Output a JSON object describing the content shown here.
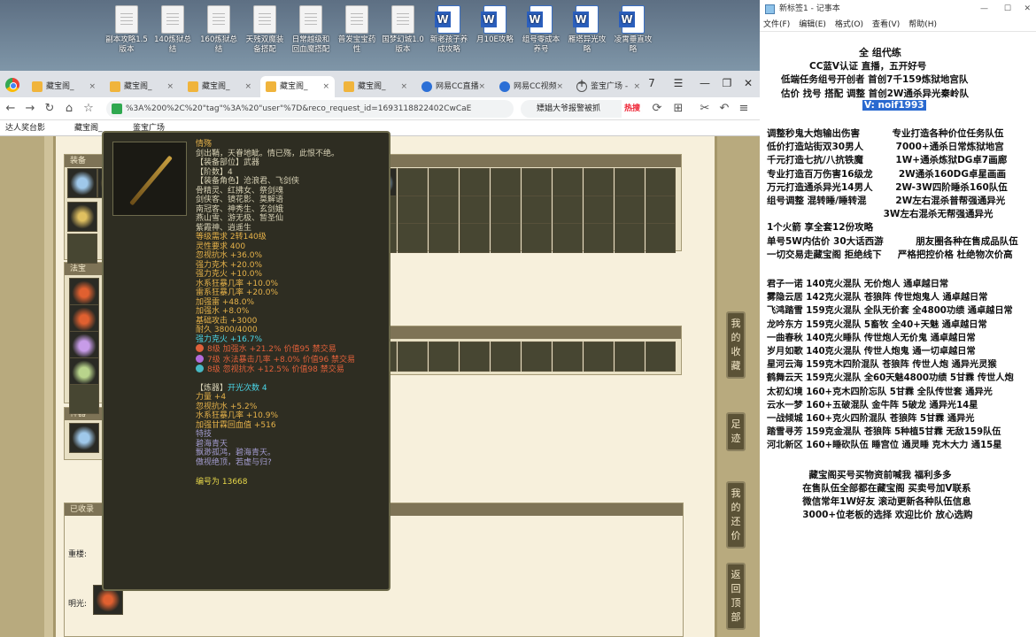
{
  "desktop": {
    "icons": [
      {
        "label": "副本攻略1.5\n版本",
        "type": "txt"
      },
      {
        "label": "140炼狱总结",
        "type": "txt"
      },
      {
        "label": "160炼狱总结",
        "type": "txt"
      },
      {
        "label": "天残双魔装\n备搭配",
        "type": "txt"
      },
      {
        "label": "日常越级和\n回血魔搭配",
        "type": "txt"
      },
      {
        "label": "普发宝宝药\n性",
        "type": "txt"
      },
      {
        "label": "国梦幻城1.0\n版本",
        "type": "txt"
      },
      {
        "label": "新老孩子养\n成攻略",
        "type": "word"
      },
      {
        "label": "月10E攻略",
        "type": "word"
      },
      {
        "label": "组号零成本\n养号",
        "type": "word"
      },
      {
        "label": "雁塔异光攻\n略",
        "type": "word"
      },
      {
        "label": "凌霄垂直攻\n略",
        "type": "word"
      }
    ]
  },
  "browser": {
    "tabs": [
      {
        "label": "藏宝阁_"
      },
      {
        "label": "藏宝阁_"
      },
      {
        "label": "藏宝阁_"
      },
      {
        "label": "藏宝阁_"
      },
      {
        "label": "藏宝阁_"
      },
      {
        "label": "网易CC直播"
      },
      {
        "label": "网易CC视频"
      },
      {
        "label": "鉴宝广场 -"
      }
    ],
    "new_tab": "+",
    "tab_count": "7",
    "url": "%3A%200%2C%20\"tag\"%3A%20\"user\"%7D&reco_request_id=1693118822402CwCaE",
    "search_text": "嫖娼大爷报警被抓",
    "search_hot": "热搜",
    "bookmarks": [
      "达人奖台影",
      "藏宝阁_",
      "鉴宝广场"
    ]
  },
  "game": {
    "equip_label": "装备",
    "items_label": "物品栏",
    "fabao_label": "法宝",
    "yuanshen_label": "神器",
    "jingmai_label": "已收录",
    "row_labels": [
      "重楼:",
      "明光:"
    ],
    "side_buttons": [
      "我的收藏",
      "足迹",
      "我的还价",
      "返回顶部"
    ]
  },
  "tooltip": {
    "name": "情殇",
    "desc": "剑出鞘，天眷地眦。情已殇，此恨不绝。",
    "lines_white": [
      "【装备部位】武器",
      "【阶数】4",
      "【装备角色】沧浪君、飞剑侠",
      "骨精灵、红拂女、祭剑魂",
      "剑侠客、镜花影、莫解语",
      "南冠客、神秀生、玄剑娥",
      "燕山雪、游无极、暂圣仙",
      "紫霞神、逍遥生"
    ],
    "lines_gold": [
      "等级需求 2转140级",
      "灵性要求 400",
      "忽视抗水 +36.0%",
      "强力克木 +20.0%",
      "强力克火 +10.0%",
      "水系狂暴几率 +10.0%",
      "雷系狂暴几率 +20.0%",
      "加强雷 +48.0%",
      "加强水 +8.0%",
      "基础攻击 +3000",
      "耐久 3800/4000"
    ],
    "cyan_line": "强力克火 +16.7%",
    "gems": [
      {
        "text": "8级 加强水 +21.2% 价值95 禁交易",
        "color": "#e0603a"
      },
      {
        "text": "7级 水法暴击几率 +8.0% 价值96 禁交易",
        "color": "#b36bdc"
      },
      {
        "text": "8级 忽视抗水 +12.5% 价值98 禁交易",
        "color": "#47b8c4"
      }
    ],
    "refine_head": "【炼器】",
    "refine_count": "开光次数 4",
    "refine_lines": [
      "力量 +4",
      "忽视抗水 +5.2%",
      "水系狂暴几率 +10.9%",
      "加强甘霖回血值 +516"
    ],
    "special_head": "特技",
    "special_lines": [
      "碧海青天",
      "飘渺孤鸿，碧海青天。",
      "傲视绝顶，若虚与归?"
    ],
    "code": "编号为 13668"
  },
  "notepad": {
    "title": "新标签1 - 记事本",
    "menu": [
      "文件(F)",
      "编辑(E)",
      "格式(O)",
      "查看(V)",
      "帮助(H)"
    ],
    "header_lines": [
      "全 组代练",
      "CC蓝V认证        直播，五开好号",
      "低端任务组号开创者        首创7千159炼狱地宫队",
      "估价 找号 搭配 调整        首创2W通杀异光秦岭队"
    ],
    "selected": "V: noif1993",
    "lines": [
      "调整秒鬼大炮输出伤害          专业打造各种价位任务队伍",
      "低价打造站街双30男人          7000+通杀日常炼狱地宫",
      "千元打造七抗/八抗铁魔          1W+通杀炼狱DG卓7画廊",
      "专业打造百万伤害16级龙        2W通杀160DG卓星画画",
      "万元打造通杀异光14男人       2W-3W四阶睡杀160队伍",
      "组号调整 混转睡/睡转混         2W左右混杀普帮强通异光",
      "                                    3W左右混杀无帮强通异光",
      "1个火箭 享全套12份攻略",
      "单号5W内估价 30大话西游          朋友圈各种在售成品队伍",
      "一切交易走藏宝阁 拒绝线下     严格把控价格 杜绝物次价高",
      "",
      "君子一诺 140克火混队 无价炮人 通卓越日常",
      "雾隐云居 142克火混队 苍狼阵 传世炮鬼人 通卓越日常",
      "飞鸿踏雪 159克火混队 全队无价套 全4800功绩 通卓越日常",
      "龙吟东方 159克火混队 5畜牧 全40+天魅 通卓越日常",
      "一曲春秋 140克火睡队 传世炮人无价鬼 通卓越日常",
      "岁月如歌 140克火混队 传世人炮鬼 通一切卓越日常",
      "星河云海 159克木四阶混队 苍狼阵 传世人炮 通异光灵猴",
      "鹤舞云天 159克火混队 全60天魅4800功绩 5甘霖 传世人炮",
      "太初幻境 160+克木四阶忘队 5甘霖 全队传世套 通异光",
      "云水一梦 160+五破混队 金牛阵 5破龙 通异光14星",
      "一战倾城 160+克火四阶混队 苍狼阵 5甘霖 通异光",
      "踏雪寻芳 159克金混队 苍狼阵 5种植5甘霖 无敌159队伍",
      "河北新区 160+睡砍队伍 睡宫位 通灵睡 克木大力 通15星",
      "",
      "             藏宝阁买号买物资前喊我 福利多多",
      "           在售队伍全部都在藏宝阁 买卖号加V联系",
      "           微信常年1W好友 滚动更新各种队伍信息",
      "           3000+位老板的选择 欢迎比价 放心选购"
    ]
  },
  "colors": {
    "tooltip_bg": "#2e2d22",
    "gold": "#e6b24a",
    "cyan": "#4ad6e8",
    "selection": "#2a6ad0"
  }
}
